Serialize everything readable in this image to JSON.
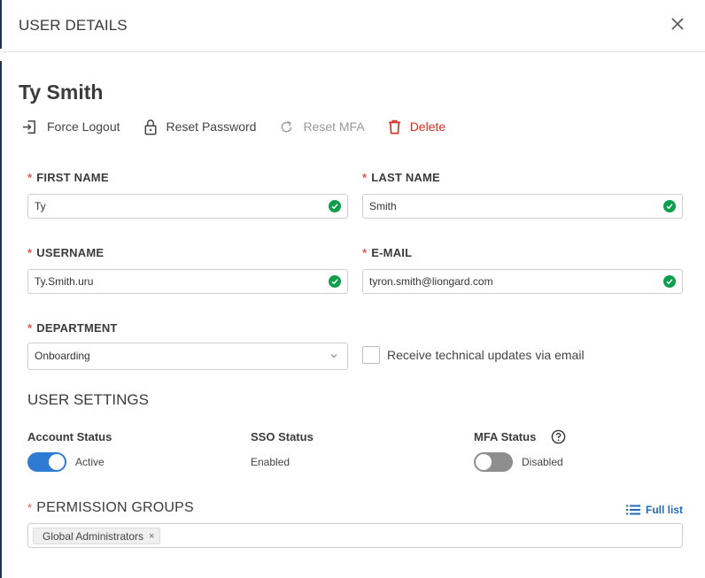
{
  "header": {
    "title": "USER DETAILS",
    "close_icon": "close-icon"
  },
  "user": {
    "name": "Ty Smith"
  },
  "actions": [
    {
      "label": "Force Logout",
      "icon": "logout-icon",
      "state": "enabled"
    },
    {
      "label": "Reset Password",
      "icon": "lock-icon",
      "state": "enabled"
    },
    {
      "label": "Reset MFA",
      "icon": "refresh-icon",
      "state": "disabled"
    },
    {
      "label": "Delete",
      "icon": "trash-icon",
      "state": "danger"
    }
  ],
  "form": {
    "required_marker": "*",
    "first_name": {
      "label": "FIRST NAME",
      "value": "Ty"
    },
    "last_name": {
      "label": "LAST NAME",
      "value": "Smith"
    },
    "username": {
      "label": "USERNAME",
      "value": "Ty.Smith.uru"
    },
    "email": {
      "label": "E-MAIL",
      "value": "tyron.smith@liongard.com"
    },
    "department": {
      "label": "DEPARTMENT",
      "value": "Onboarding"
    },
    "technical_updates": {
      "label": "Receive technical updates via email",
      "checked": false
    }
  },
  "settings": {
    "title": "USER SETTINGS",
    "account_status": {
      "label": "Account Status",
      "value": "Active",
      "on": true
    },
    "sso_status": {
      "label": "SSO Status",
      "value": "Enabled"
    },
    "mfa_status": {
      "label": "MFA Status",
      "value": "Disabled",
      "on": false
    }
  },
  "permissions": {
    "label": "PERMISSION GROUPS",
    "full_list_label": "Full list",
    "tags": [
      "Global Administrators"
    ],
    "tag_remove": "×"
  },
  "colors": {
    "accent": "#2f7bd3",
    "success": "#0d9e4c",
    "danger": "#d9301f",
    "link": "#2369b8",
    "required": "#e2574c"
  }
}
